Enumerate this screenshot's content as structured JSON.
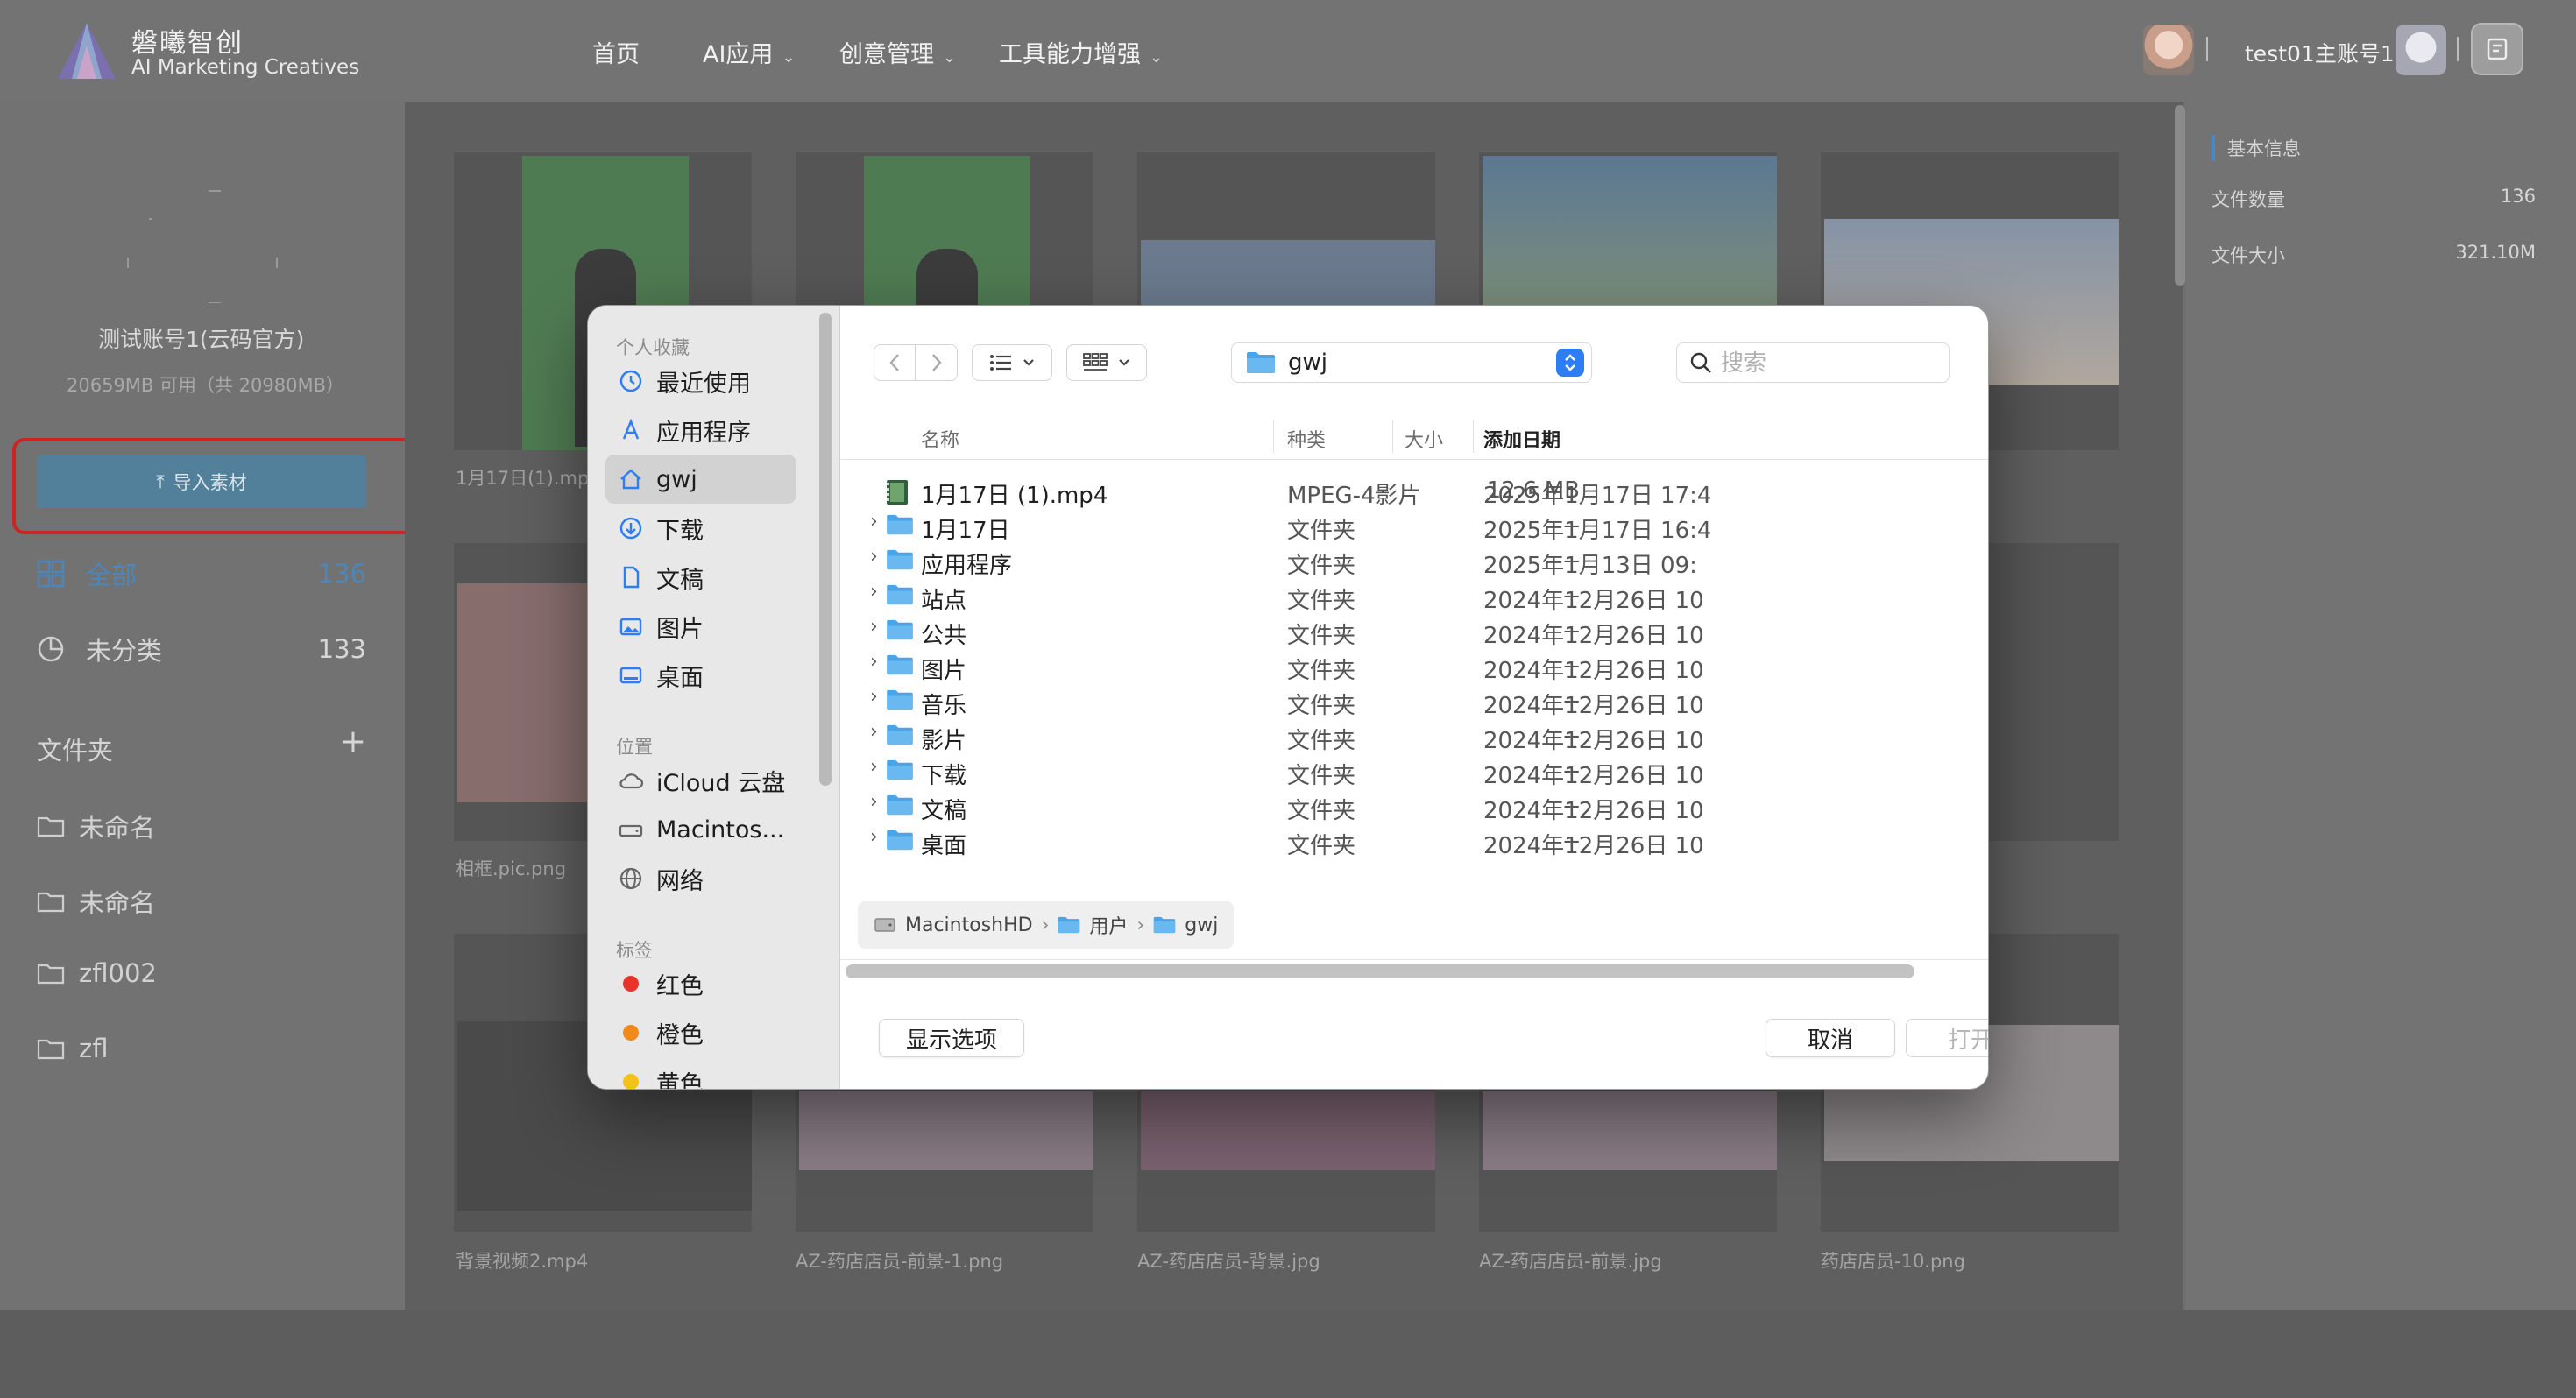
{
  "app": {
    "brand_name": "磐曦智创",
    "brand_sub": "AI Marketing Creatives",
    "nav": [
      "首页",
      "AI应用",
      "创意管理",
      "工具能力增强"
    ],
    "user_name": "test01主账号1"
  },
  "sidebar": {
    "account_name": "测试账号1(云码官方)",
    "storage": "20659MB 可用（共 20980MB）",
    "import_label": "导入素材",
    "all_label": "全部",
    "all_count": "136",
    "uncat_label": "未分类",
    "uncat_count": "133",
    "folders_label": "文件夹",
    "folders": [
      "未命名",
      "未命名",
      "zfl002",
      "zfl"
    ]
  },
  "grid": {
    "labels": [
      "1月17日(1).mp",
      "相框.pic.png",
      "背景视频2.mp4",
      "AZ-药店店员-前景-1.png",
      "AZ-药店店员-背景.jpg",
      "AZ-药店店员-前景.jpg",
      "药店店员-10.png"
    ]
  },
  "info_panel": {
    "title": "基本信息",
    "file_count_label": "文件数量",
    "file_count": "136",
    "file_size_label": "文件大小",
    "file_size": "321.10M"
  },
  "dialog": {
    "sidebar": {
      "favorites_label": "个人收藏",
      "favorites": [
        {
          "label": "最近使用",
          "icon": "clock-icon"
        },
        {
          "label": "应用程序",
          "icon": "apps-icon"
        },
        {
          "label": "gwj",
          "icon": "home-icon"
        },
        {
          "label": "下载",
          "icon": "download-icon"
        },
        {
          "label": "文稿",
          "icon": "document-icon"
        },
        {
          "label": "图片",
          "icon": "photo-icon"
        },
        {
          "label": "桌面",
          "icon": "desktop-icon"
        }
      ],
      "locations_label": "位置",
      "locations": [
        {
          "label": "iCloud 云盘",
          "icon": "cloud-icon"
        },
        {
          "label": "Macintos...",
          "icon": "disk-icon"
        },
        {
          "label": "网络",
          "icon": "network-icon"
        }
      ],
      "tags_label": "标签",
      "tags": [
        {
          "label": "红色",
          "color": "#e8332a"
        },
        {
          "label": "橙色",
          "color": "#f08a1c"
        },
        {
          "label": "黄色",
          "color": "#f2c21b"
        }
      ]
    },
    "current_folder": "gwj",
    "search_placeholder": "搜索",
    "columns": {
      "name": "名称",
      "size": "大小",
      "kind": "种类",
      "date": "添加日期"
    },
    "files": [
      {
        "name": "1月17日 (1).mp4",
        "size": "12.6 MB",
        "kind": "MPEG-4影片",
        "date": "2025年1月17日 17:4",
        "type": "video"
      },
      {
        "name": "1月17日",
        "size": "--",
        "kind": "文件夹",
        "date": "2025年1月17日 16:4",
        "type": "folder"
      },
      {
        "name": "应用程序",
        "size": "--",
        "kind": "文件夹",
        "date": "2025年1月13日 09:",
        "type": "folder"
      },
      {
        "name": "站点",
        "size": "--",
        "kind": "文件夹",
        "date": "2024年12月26日 10",
        "type": "folder"
      },
      {
        "name": "公共",
        "size": "--",
        "kind": "文件夹",
        "date": "2024年12月26日 10",
        "type": "folder"
      },
      {
        "name": "图片",
        "size": "--",
        "kind": "文件夹",
        "date": "2024年12月26日 10",
        "type": "folder"
      },
      {
        "name": "音乐",
        "size": "--",
        "kind": "文件夹",
        "date": "2024年12月26日 10",
        "type": "folder"
      },
      {
        "name": "影片",
        "size": "--",
        "kind": "文件夹",
        "date": "2024年12月26日 10",
        "type": "folder"
      },
      {
        "name": "下载",
        "size": "--",
        "kind": "文件夹",
        "date": "2024年12月26日 10",
        "type": "folder"
      },
      {
        "name": "文稿",
        "size": "--",
        "kind": "文件夹",
        "date": "2024年12月26日 10",
        "type": "folder"
      },
      {
        "name": "桌面",
        "size": "--",
        "kind": "文件夹",
        "date": "2024年12月26日 10",
        "type": "folder"
      }
    ],
    "breadcrumb": [
      "MacintoshHD",
      "用户",
      "gwj"
    ],
    "show_options_label": "显示选项",
    "cancel_label": "取消",
    "open_label": "打开",
    "accent_color": "#2d7ef3"
  }
}
